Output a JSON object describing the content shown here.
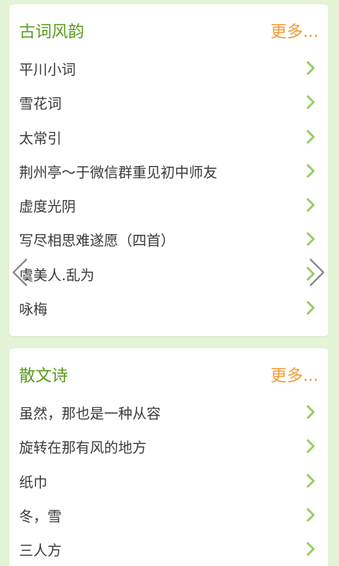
{
  "sections": [
    {
      "title": "古词风韵",
      "more_label": "更多...",
      "items": [
        "平川小词",
        "雪花词",
        "太常引",
        "荆州亭～于微信群重见初中师友",
        "虚度光阴",
        "写尽相思难遂愿（四首）",
        "虞美人.乱为",
        "咏梅"
      ]
    },
    {
      "title": "散文诗",
      "more_label": "更多...",
      "items": [
        "虽然，那也是一种从容",
        "旋转在那有风的地方",
        "纸巾",
        "冬，雪",
        "三人方"
      ]
    }
  ],
  "icons": {
    "row_arrow": "chevron-right-icon",
    "carousel_prev": "chevron-left-icon",
    "carousel_next": "chevron-right-icon"
  },
  "colors": {
    "background": "#e4f4d6",
    "title": "#5b9a1c",
    "more": "#f39b2f",
    "item_text": "#3a3a3a",
    "row_arrow": "#8fcf5e"
  }
}
